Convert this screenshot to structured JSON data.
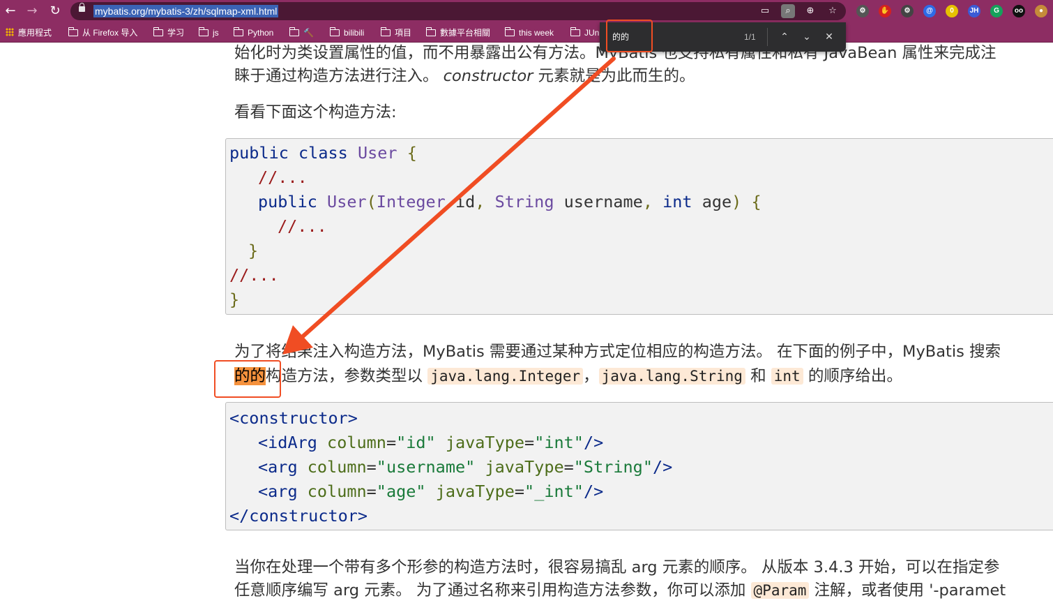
{
  "browser": {
    "url": "mybatis.org/mybatis-3/zh/sqlmap-xml.html",
    "nav": {
      "back": "←",
      "forward": "→",
      "reload": "↻"
    },
    "omnibox_icons": [
      "cast-icon",
      "find-in-page-icon",
      "zoom-icon",
      "bookmark-star-icon"
    ],
    "extensions": [
      {
        "name": "ext-settings-icon",
        "glyph": "⚙",
        "color": "#555555"
      },
      {
        "name": "ext-shield-icon",
        "glyph": "✋",
        "color": "#d42020"
      },
      {
        "name": "ext-gear-icon",
        "glyph": "⚙",
        "color": "#444444"
      },
      {
        "name": "ext-at-icon",
        "glyph": "@",
        "color": "#2e6be6"
      },
      {
        "name": "ext-note-icon",
        "glyph": "0",
        "color": "#e6c100"
      },
      {
        "name": "ext-jh-icon",
        "glyph": "JH",
        "color": "#3b5bd6"
      },
      {
        "name": "ext-grammarly-icon",
        "glyph": "G",
        "color": "#15a15b"
      },
      {
        "name": "ext-eyes-icon",
        "glyph": "oo",
        "color": "#111111"
      },
      {
        "name": "ext-cookie-icon",
        "glyph": "●",
        "color": "#c58b3a"
      }
    ],
    "bookmarks": [
      {
        "label": "應用程式",
        "icon": "apps-grid-icon"
      },
      {
        "label": "从 Firefox 导入",
        "icon": "folder-icon"
      },
      {
        "label": "学习",
        "icon": "folder-icon"
      },
      {
        "label": "js",
        "icon": "folder-icon"
      },
      {
        "label": "Python",
        "icon": "folder-icon"
      },
      {
        "label": "🔨",
        "icon": "folder-icon"
      },
      {
        "label": "bilibili",
        "icon": "folder-icon"
      },
      {
        "label": "項目",
        "icon": "folder-icon"
      },
      {
        "label": "數據平台相關",
        "icon": "folder-icon"
      },
      {
        "label": "this week",
        "icon": "folder-icon"
      },
      {
        "label": "JUn",
        "icon": "folder-icon"
      }
    ]
  },
  "findbar": {
    "query": "的的",
    "count": "1/1",
    "prev": "⌃",
    "next": "⌄",
    "close": "✕"
  },
  "content": {
    "p1_line1": "始化时为类设置属性的值，而不用暴露出公有方法。MyBatis 也支持私有属性和私有 JavaBean 属性来完成注",
    "p1_line2_a": "睐于通过构造方法进行注入。",
    "p1_line2_em": "constructor",
    "p1_line2_b": " 元素就是为此而生的。",
    "p2": "看看下面这个构造方法:",
    "p3_line1": "为了将结果注入构造方法，MyBatis 需要通过某种方式定位相应的构造方法。 在下面的例子中，MyBatis 搜索",
    "p3_match": "的的",
    "p3_line2_a": "构造方法，参数类型以",
    "p3_code1": "java.lang.Integer",
    "p3_sep": "，",
    "p3_code2": "java.lang.String",
    "p3_and": " 和 ",
    "p3_code3": "int",
    "p3_line2_b": " 的顺序给出。",
    "p4_line1": "当你在处理一个带有多个形参的构造方法时，很容易搞乱 arg 元素的顺序。 从版本 3.4.3 开始，可以在指定参",
    "p4_line2_a": "任意顺序编写 arg 元素。 为了通过名称来引用构造方法参数，你可以添加",
    "p4_code": "@Param",
    "p4_line2_b": " 注解，或者使用 '-paramet"
  },
  "java_code": {
    "l1_kw": "public class",
    "l1_ty": "User",
    "l1_br": "{",
    "l2": "//...",
    "l3_kw": "public",
    "l3_ty": "User",
    "l3_p1": "(",
    "l3_t1": "Integer",
    "l3_v1": " id",
    "l3_c1": ", ",
    "l3_t2": "String",
    "l3_v2": " username",
    "l3_c2": ", ",
    "l3_t3": "int",
    "l3_v3": " age",
    "l3_p2": ") {",
    "l4": "//...",
    "l5": "}",
    "l6": "//...",
    "l7": "}"
  },
  "xml_code": {
    "l1": "<constructor>",
    "l2_tag": "<idArg",
    "l2_a1": "column",
    "l2_v1": "\"id\"",
    "l2_a2": "javaType",
    "l2_v2": "\"int\"",
    "l2_end": "/>",
    "l3_tag": "<arg",
    "l3_a1": "column",
    "l3_v1": "\"username\"",
    "l3_a2": "javaType",
    "l3_v2": "\"String\"",
    "l3_end": "/>",
    "l4_tag": "<arg",
    "l4_a1": "column",
    "l4_v1": "\"age\"",
    "l4_a2": "javaType",
    "l4_v2": "\"_int\"",
    "l4_end": "/>",
    "l5": "</constructor>",
    "eq": "="
  },
  "colors": {
    "chrome": "#8d2d63",
    "annotation": "#f04d23",
    "match_highlight": "#f5913c"
  }
}
